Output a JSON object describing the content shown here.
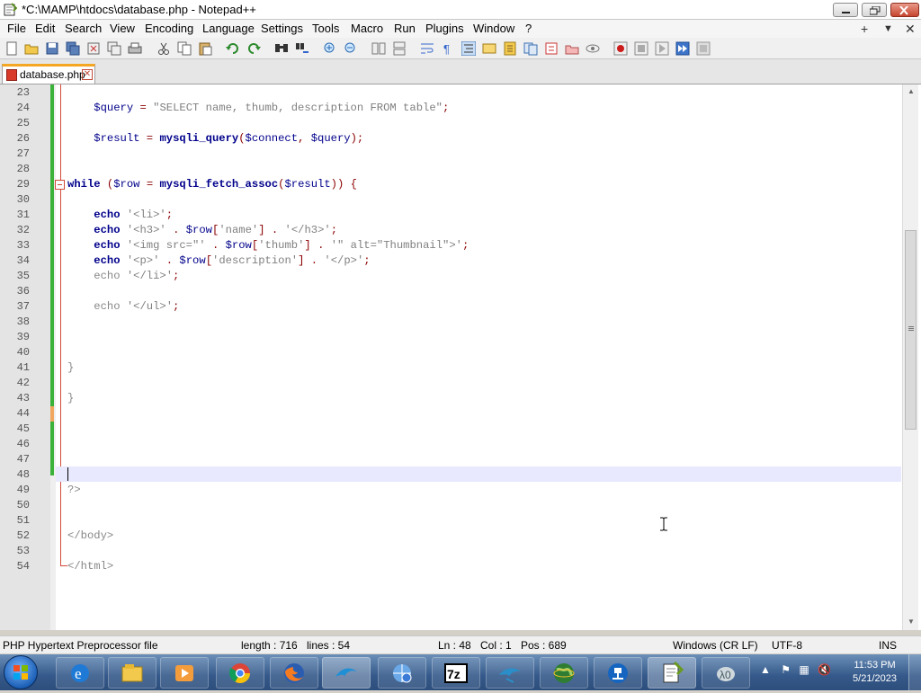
{
  "window": {
    "title": "*C:\\MAMP\\htdocs\\database.php - Notepad++"
  },
  "menu": {
    "items": [
      "File",
      "Edit",
      "Search",
      "View",
      "Encoding",
      "Language",
      "Settings",
      "Tools",
      "Macro",
      "Run",
      "Plugins",
      "Window",
      "?"
    ],
    "right": [
      "+",
      "▼",
      "✕"
    ]
  },
  "toolbar": {
    "buttons": [
      "new-file-icon",
      "open-file-icon",
      "save-icon",
      "save-all-icon",
      "close-icon",
      "close-all-icon",
      "print-icon",
      "cut-icon",
      "copy-icon",
      "paste-icon",
      "undo-icon",
      "redo-icon",
      "find-icon",
      "replace-icon",
      "zoom-in-icon",
      "zoom-out-icon",
      "sync-v-icon",
      "sync-h-icon",
      "word-wrap-icon",
      "all-chars-icon",
      "indent-guide-icon",
      "user-lang-icon",
      "doc-map-icon",
      "func-list-icon",
      "folder-workspace-icon",
      "doc-switcher-icon",
      "monitor-icon",
      "record-macro-icon",
      "stop-macro-icon",
      "play-macro-icon",
      "run-macro-multiple-icon",
      "save-macro-icon"
    ]
  },
  "tabs": [
    {
      "label": "database.php"
    }
  ],
  "editor": {
    "lines": [
      {
        "n": "23",
        "tokens": []
      },
      {
        "n": "24",
        "tokens": [
          [
            "plain",
            "    "
          ],
          [
            "var",
            "$query"
          ],
          [
            "plain",
            " "
          ],
          [
            "op",
            "="
          ],
          [
            "plain",
            " "
          ],
          [
            "str",
            "\"SELECT name, thumb, description FROM table\""
          ],
          [
            "op",
            ";"
          ]
        ]
      },
      {
        "n": "25",
        "tokens": []
      },
      {
        "n": "26",
        "tokens": [
          [
            "plain",
            "    "
          ],
          [
            "var",
            "$result"
          ],
          [
            "plain",
            " "
          ],
          [
            "op",
            "="
          ],
          [
            "plain",
            " "
          ],
          [
            "fn",
            "mysqli_query"
          ],
          [
            "op",
            "("
          ],
          [
            "var",
            "$connect"
          ],
          [
            "op",
            ","
          ],
          [
            "plain",
            " "
          ],
          [
            "var",
            "$query"
          ],
          [
            "op",
            ");"
          ]
        ]
      },
      {
        "n": "27",
        "tokens": []
      },
      {
        "n": "28",
        "tokens": []
      },
      {
        "n": "29",
        "tokens": [
          [
            "kw",
            "while"
          ],
          [
            "plain",
            " "
          ],
          [
            "op",
            "("
          ],
          [
            "var",
            "$row"
          ],
          [
            "plain",
            " "
          ],
          [
            "op",
            "="
          ],
          [
            "plain",
            " "
          ],
          [
            "fn",
            "mysqli_fetch_assoc"
          ],
          [
            "op",
            "("
          ],
          [
            "var",
            "$result"
          ],
          [
            "op",
            "))"
          ],
          [
            "plain",
            " "
          ],
          [
            "op",
            "{"
          ]
        ]
      },
      {
        "n": "30",
        "tokens": []
      },
      {
        "n": "31",
        "tokens": [
          [
            "plain",
            "    "
          ],
          [
            "kw",
            "echo"
          ],
          [
            "plain",
            " "
          ],
          [
            "str",
            "'<li>'"
          ],
          [
            "op",
            ";"
          ]
        ]
      },
      {
        "n": "32",
        "tokens": [
          [
            "plain",
            "    "
          ],
          [
            "kw",
            "echo"
          ],
          [
            "plain",
            " "
          ],
          [
            "str",
            "'<h3>'"
          ],
          [
            "plain",
            " "
          ],
          [
            "op",
            "."
          ],
          [
            "plain",
            " "
          ],
          [
            "var",
            "$row"
          ],
          [
            "op",
            "["
          ],
          [
            "str",
            "'name'"
          ],
          [
            "op",
            "]"
          ],
          [
            "plain",
            " "
          ],
          [
            "op",
            "."
          ],
          [
            "plain",
            " "
          ],
          [
            "str",
            "'</h3>'"
          ],
          [
            "op",
            ";"
          ]
        ]
      },
      {
        "n": "33",
        "tokens": [
          [
            "plain",
            "    "
          ],
          [
            "kw",
            "echo"
          ],
          [
            "plain",
            " "
          ],
          [
            "str",
            "'<img src=\"'"
          ],
          [
            "plain",
            " "
          ],
          [
            "op",
            "."
          ],
          [
            "plain",
            " "
          ],
          [
            "var",
            "$row"
          ],
          [
            "op",
            "["
          ],
          [
            "str",
            "'thumb'"
          ],
          [
            "op",
            "]"
          ],
          [
            "plain",
            " "
          ],
          [
            "op",
            "."
          ],
          [
            "plain",
            " "
          ],
          [
            "str",
            "'\" alt=\"Thumbnail\">'"
          ],
          [
            "op",
            ";"
          ]
        ]
      },
      {
        "n": "34",
        "tokens": [
          [
            "plain",
            "    "
          ],
          [
            "kw",
            "echo"
          ],
          [
            "plain",
            " "
          ],
          [
            "str",
            "'<p>'"
          ],
          [
            "plain",
            " "
          ],
          [
            "op",
            "."
          ],
          [
            "plain",
            " "
          ],
          [
            "var",
            "$row"
          ],
          [
            "op",
            "["
          ],
          [
            "str",
            "'description'"
          ],
          [
            "op",
            "]"
          ],
          [
            "plain",
            " "
          ],
          [
            "op",
            "."
          ],
          [
            "plain",
            " "
          ],
          [
            "str",
            "'</p>'"
          ],
          [
            "op",
            ";"
          ]
        ]
      },
      {
        "n": "35",
        "tokens": [
          [
            "plain",
            "    echo "
          ],
          [
            "str",
            "'</li>'"
          ],
          [
            "op",
            ";"
          ]
        ]
      },
      {
        "n": "36",
        "tokens": []
      },
      {
        "n": "37",
        "tokens": [
          [
            "plain",
            "    echo "
          ],
          [
            "str",
            "'</ul>'"
          ],
          [
            "op",
            ";"
          ]
        ]
      },
      {
        "n": "38",
        "tokens": []
      },
      {
        "n": "39",
        "tokens": []
      },
      {
        "n": "40",
        "tokens": []
      },
      {
        "n": "41",
        "tokens": [
          [
            "plain",
            "}"
          ]
        ]
      },
      {
        "n": "42",
        "tokens": []
      },
      {
        "n": "43",
        "tokens": [
          [
            "plain",
            "}"
          ]
        ]
      },
      {
        "n": "44",
        "tokens": []
      },
      {
        "n": "45",
        "tokens": []
      },
      {
        "n": "46",
        "tokens": []
      },
      {
        "n": "47",
        "tokens": []
      },
      {
        "n": "48",
        "tokens": []
      },
      {
        "n": "49",
        "tokens": [
          [
            "html",
            "?>"
          ]
        ]
      },
      {
        "n": "50",
        "tokens": []
      },
      {
        "n": "51",
        "tokens": []
      },
      {
        "n": "52",
        "tokens": [
          [
            "html",
            "</body>"
          ]
        ]
      },
      {
        "n": "53",
        "tokens": []
      },
      {
        "n": "54",
        "tokens": [
          [
            "html",
            "</html>"
          ]
        ]
      }
    ]
  },
  "status": {
    "file_type": "PHP Hypertext Preprocessor file",
    "length": "length : 716",
    "lines": "lines : 54",
    "ln": "Ln : 48",
    "col": "Col : 1",
    "pos": "Pos : 689",
    "eol": "Windows (CR LF)",
    "encoding": "UTF-8",
    "mode": "INS"
  },
  "taskbar": {
    "apps": [
      "internet-explorer-icon",
      "file-explorer-icon",
      "media-player-icon",
      "chrome-icon",
      "firefox-icon",
      "mysql-dolphin-icon",
      "network-globe-icon",
      "seven-zip-icon",
      "mysql-workbench-icon",
      "globe-icon",
      "network-drive-icon",
      "notepadpp-icon",
      "mamp-icon"
    ],
    "clock_time": "11:53 PM",
    "clock_date": "5/21/2023"
  }
}
